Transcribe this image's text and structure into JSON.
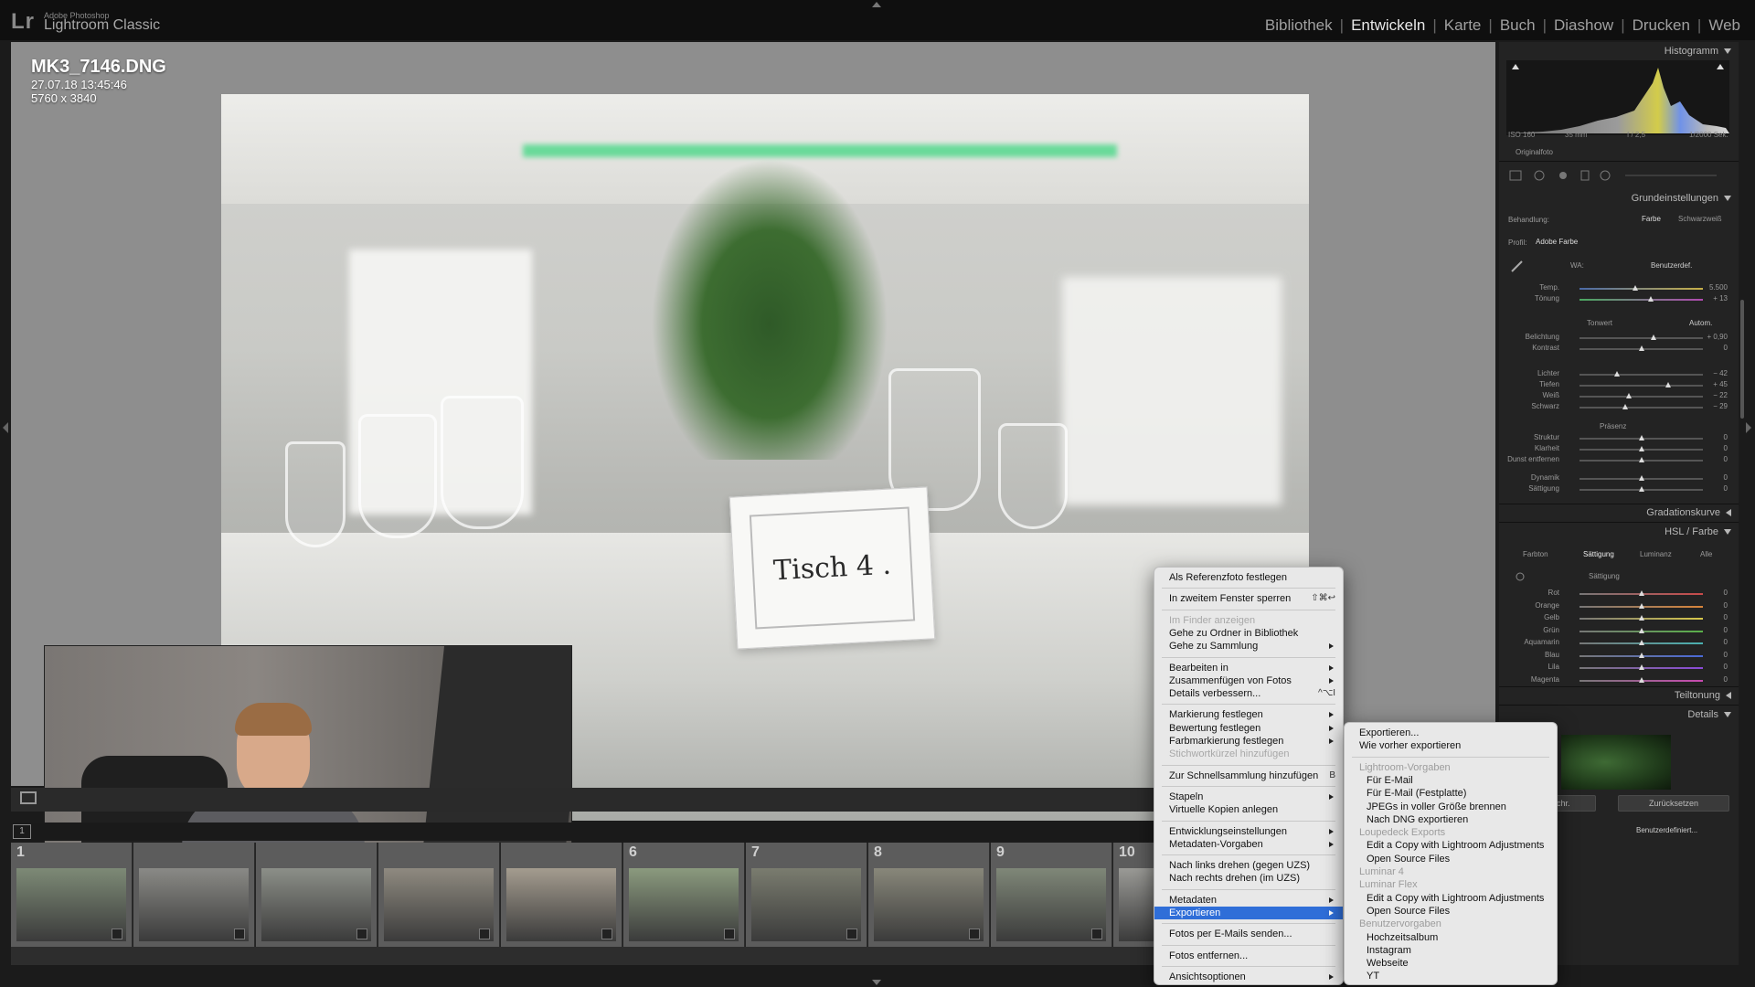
{
  "app": {
    "logo": "Lr",
    "brand_small": "Adobe Photoshop",
    "brand": "Lightroom Classic",
    "modules": [
      "Bibliothek",
      "Entwickeln",
      "Karte",
      "Buch",
      "Diashow",
      "Drucken",
      "Web"
    ],
    "active_module": "Entwickeln"
  },
  "photo": {
    "filename": "MK3_7146.DNG",
    "date": "27.07.18 13:45:46",
    "dimensions": "5760 x 3840",
    "card_text": "Tisch 4 ."
  },
  "filmstrip": {
    "page_button": "1",
    "numbers": [
      "1",
      "",
      "",
      "",
      "",
      "6",
      "7",
      "8",
      "9",
      "10"
    ]
  },
  "right_panel": {
    "histogram_title": "Histogramm",
    "hist_meta": [
      "ISO 160",
      "35 mm",
      "f / 2,5",
      "1/2000 Sek."
    ],
    "original_photo": "Originalfoto",
    "basic_title": "Grundeinstellungen",
    "treatment_label": "Behandlung:",
    "treatment_color": "Farbe",
    "treatment_bw": "Schwarzweiß",
    "profile_label": "Profil:",
    "profile_value": "Adobe Farbe",
    "wb_label": "WA:",
    "wb_value": "Benutzerdef.",
    "tone_label": "Tonwert",
    "tone_auto": "Autom.",
    "presence_label": "Präsenz",
    "sliders": [
      {
        "label": "Temp.",
        "value": "5.500",
        "pos": 0.45
      },
      {
        "label": "Tönung",
        "value": "+ 13",
        "pos": 0.58
      },
      {
        "label": "Belichtung",
        "value": "+ 0,90",
        "pos": 0.6
      },
      {
        "label": "Kontrast",
        "value": "0",
        "pos": 0.5
      },
      {
        "label": "Lichter",
        "value": "− 42",
        "pos": 0.3
      },
      {
        "label": "Tiefen",
        "value": "+ 45",
        "pos": 0.72
      },
      {
        "label": "Weiß",
        "value": "− 22",
        "pos": 0.4
      },
      {
        "label": "Schwarz",
        "value": "− 29",
        "pos": 0.37
      },
      {
        "label": "Struktur",
        "value": "0",
        "pos": 0.5
      },
      {
        "label": "Klarheit",
        "value": "0",
        "pos": 0.5
      },
      {
        "label": "Dunst entfernen",
        "value": "0",
        "pos": 0.5
      },
      {
        "label": "Dynamik",
        "value": "0",
        "pos": 0.5
      },
      {
        "label": "Sättigung",
        "value": "0",
        "pos": 0.5
      }
    ],
    "gradation_title": "Gradationskurve",
    "hsl_title": "HSL / Farbe",
    "hsl_tabs": [
      "Farbton",
      "Sättigung",
      "Luminanz",
      "Alle"
    ],
    "hsl_section": "Sättigung",
    "hsl_sliders": [
      {
        "label": "Rot",
        "value": "0"
      },
      {
        "label": "Orange",
        "value": "0"
      },
      {
        "label": "Gelb",
        "value": "0"
      },
      {
        "label": "Grün",
        "value": "0"
      },
      {
        "label": "Aquamarin",
        "value": "0"
      },
      {
        "label": "Blau",
        "value": "0"
      },
      {
        "label": "Lila",
        "value": "0"
      },
      {
        "label": "Magenta",
        "value": "0"
      }
    ],
    "split_title": "Teiltonung",
    "details_title": "Details",
    "sync_btn": "m. synchr.",
    "reset_btn": "Zurücksetzen",
    "custom_btn": "Benutzerdefiniert..."
  },
  "context_menu": {
    "items": [
      {
        "label": "Als Referenzfoto festlegen"
      },
      {
        "sep": true
      },
      {
        "label": "In zweitem Fenster sperren",
        "shortcut": "⇧⌘↩"
      },
      {
        "sep": true
      },
      {
        "label": "Im Finder anzeigen",
        "disabled": true
      },
      {
        "label": "Gehe zu Ordner in Bibliothek"
      },
      {
        "label": "Gehe zu Sammlung",
        "submenu": true
      },
      {
        "sep": true
      },
      {
        "label": "Bearbeiten in",
        "submenu": true
      },
      {
        "label": "Zusammenfügen von Fotos",
        "submenu": true
      },
      {
        "label": "Details verbessern...",
        "shortcut": "^⌥I"
      },
      {
        "sep": true
      },
      {
        "label": "Markierung festlegen",
        "submenu": true
      },
      {
        "label": "Bewertung festlegen",
        "submenu": true
      },
      {
        "label": "Farbmarkierung festlegen",
        "submenu": true
      },
      {
        "label": "Stichwortkürzel hinzufügen",
        "disabled": true
      },
      {
        "sep": true
      },
      {
        "label": "Zur Schnellsammlung hinzufügen",
        "shortcut": "B"
      },
      {
        "sep": true
      },
      {
        "label": "Stapeln",
        "submenu": true
      },
      {
        "label": "Virtuelle Kopien anlegen"
      },
      {
        "sep": true
      },
      {
        "label": "Entwicklungseinstellungen",
        "submenu": true
      },
      {
        "label": "Metadaten-Vorgaben",
        "submenu": true
      },
      {
        "sep": true
      },
      {
        "label": "Nach links drehen (gegen UZS)"
      },
      {
        "label": "Nach rechts drehen (im UZS)"
      },
      {
        "sep": true
      },
      {
        "label": "Metadaten",
        "submenu": true
      },
      {
        "label": "Exportieren",
        "submenu": true,
        "highlight": true
      },
      {
        "sep": true
      },
      {
        "label": "Fotos per E-Mails senden..."
      },
      {
        "sep": true
      },
      {
        "label": "Fotos entfernen..."
      },
      {
        "sep": true
      },
      {
        "label": "Ansichtsoptionen",
        "submenu": true
      }
    ]
  },
  "export_submenu": {
    "items": [
      {
        "label": "Exportieren..."
      },
      {
        "label": "Wie vorher exportieren"
      },
      {
        "sep": true
      },
      {
        "label": "Lightroom-Vorgaben",
        "category": true
      },
      {
        "label": "Für E-Mail",
        "indent": true
      },
      {
        "label": "Für E-Mail (Festplatte)",
        "indent": true
      },
      {
        "label": "JPEGs in voller Größe brennen",
        "indent": true
      },
      {
        "label": "Nach DNG exportieren",
        "indent": true
      },
      {
        "label": "Loupedeck Exports",
        "category": true
      },
      {
        "label": "Edit a Copy with Lightroom Adjustments",
        "indent": true
      },
      {
        "label": "Open Source Files",
        "indent": true
      },
      {
        "label": "Luminar 4",
        "category": true
      },
      {
        "label": "Luminar Flex",
        "category": true
      },
      {
        "label": "Edit a Copy with Lightroom Adjustments",
        "indent": true
      },
      {
        "label": "Open Source Files",
        "indent": true
      },
      {
        "label": "Benutzervorgaben",
        "category": true
      },
      {
        "label": "Hochzeitsalbum",
        "indent": true
      },
      {
        "label": "Instagram",
        "indent": true
      },
      {
        "label": "Webseite",
        "indent": true
      },
      {
        "label": "YT",
        "indent": true
      }
    ]
  },
  "colors": {
    "menu_highlight": "#2f6ed8",
    "menu_bg": "#e8e8e8",
    "panel_bg": "#232323",
    "viewer_bg": "#8e8e8e"
  }
}
